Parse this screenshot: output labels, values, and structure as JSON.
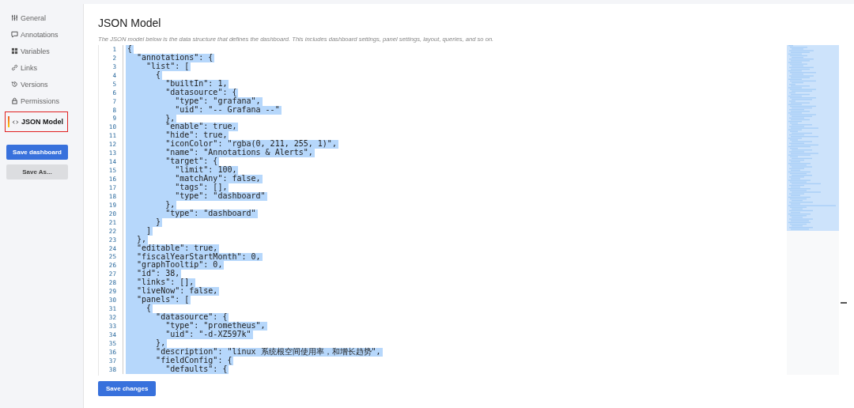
{
  "sidebar": {
    "items": [
      {
        "label": "General",
        "selected": false
      },
      {
        "label": "Annotations",
        "selected": false
      },
      {
        "label": "Variables",
        "selected": false
      },
      {
        "label": "Links",
        "selected": false
      },
      {
        "label": "Versions",
        "selected": false
      },
      {
        "label": "Permissions",
        "selected": false
      },
      {
        "label": "JSON Model",
        "selected": true
      }
    ],
    "buttons": [
      {
        "label": "Save dashboard",
        "kind": "primary"
      },
      {
        "label": "Save As...",
        "kind": "secondary"
      }
    ]
  },
  "main": {
    "title": "JSON Model",
    "description": "The JSON model below is the data structure that defines the dashboard. This includes dashboard settings, panel settings, layout, queries, and so on.",
    "editor": {
      "selected": true,
      "lines": [
        {
          "number": "1",
          "text": "{"
        },
        {
          "number": "2",
          "text": "  \"annotations\": {"
        },
        {
          "number": "3",
          "text": "    \"list\": ["
        },
        {
          "number": "4",
          "text": "      {"
        },
        {
          "number": "5",
          "text": "        \"builtIn\": 1,"
        },
        {
          "number": "6",
          "text": "        \"datasource\": {"
        },
        {
          "number": "7",
          "text": "          \"type\": \"grafana\","
        },
        {
          "number": "8",
          "text": "          \"uid\": \"-- Grafana --\""
        },
        {
          "number": "9",
          "text": "        },"
        },
        {
          "number": "10",
          "text": "        \"enable\": true,"
        },
        {
          "number": "11",
          "text": "        \"hide\": true,"
        },
        {
          "number": "12",
          "text": "        \"iconColor\": \"rgba(0, 211, 255, 1)\","
        },
        {
          "number": "13",
          "text": "        \"name\": \"Annotations & Alerts\","
        },
        {
          "number": "14",
          "text": "        \"target\": {"
        },
        {
          "number": "15",
          "text": "          \"limit\": 100,"
        },
        {
          "number": "16",
          "text": "          \"matchAny\": false,"
        },
        {
          "number": "17",
          "text": "          \"tags\": [],"
        },
        {
          "number": "18",
          "text": "          \"type\": \"dashboard\""
        },
        {
          "number": "19",
          "text": "        },"
        },
        {
          "number": "20",
          "text": "        \"type\": \"dashboard\""
        },
        {
          "number": "21",
          "text": "      }"
        },
        {
          "number": "22",
          "text": "    ]"
        },
        {
          "number": "23",
          "text": "  },"
        },
        {
          "number": "24",
          "text": "  \"editable\": true,"
        },
        {
          "number": "25",
          "text": "  \"fiscalYearStartMonth\": 0,"
        },
        {
          "number": "26",
          "text": "  \"graphTooltip\": 0,"
        },
        {
          "number": "27",
          "text": "  \"id\": 38,"
        },
        {
          "number": "28",
          "text": "  \"links\": [],"
        },
        {
          "number": "29",
          "text": "  \"liveNow\": false,"
        },
        {
          "number": "30",
          "text": "  \"panels\": ["
        },
        {
          "number": "31",
          "text": "    {"
        },
        {
          "number": "32",
          "text": "      \"datasource\": {"
        },
        {
          "number": "33",
          "text": "        \"type\": \"prometheus\","
        },
        {
          "number": "34",
          "text": "        \"uid\": \"-d-XZ597k\""
        },
        {
          "number": "35",
          "text": "      },"
        },
        {
          "number": "36",
          "text": "      \"description\": \"linux 系统根空间使用率，和增长趋势\","
        },
        {
          "number": "37",
          "text": "      \"fieldConfig\": {"
        },
        {
          "number": "38",
          "text": "        \"defaults\": {"
        }
      ]
    },
    "save_button": "Save changes"
  }
}
